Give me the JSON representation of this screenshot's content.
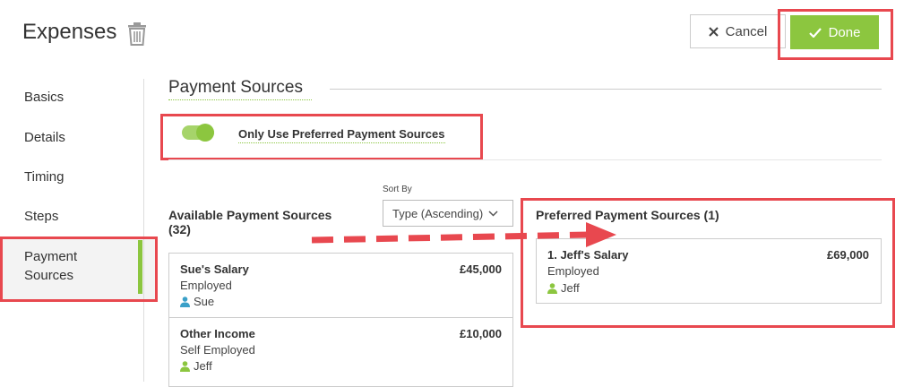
{
  "header": {
    "title": "Expenses",
    "cancel_label": "Cancel",
    "done_label": "Done"
  },
  "sidebar": {
    "items": [
      {
        "label": "Basics"
      },
      {
        "label": "Details"
      },
      {
        "label": "Timing"
      },
      {
        "label": "Steps"
      },
      {
        "label": "Payment Sources",
        "line1": "Payment",
        "line2": "Sources",
        "active": true
      }
    ]
  },
  "main": {
    "section_title": "Payment Sources",
    "toggle": {
      "label": "Only Use Preferred Payment Sources",
      "on": true
    },
    "available": {
      "title": "Available Payment Sources",
      "count": "(32)",
      "sort_label": "Sort By",
      "sort_value": "Type (Ascending)",
      "items": [
        {
          "name": "Sue's Salary",
          "type": "Employed",
          "person": "Sue",
          "amount": "£45,000",
          "person_color": "#3aa0c8"
        },
        {
          "name": "Other Income",
          "type": "Self Employed",
          "person": "Jeff",
          "amount": "£10,000",
          "person_color": "#8cc63f"
        }
      ]
    },
    "preferred": {
      "title": "Preferred Payment Sources (1)",
      "items": [
        {
          "name": "1. Jeff's Salary",
          "type": "Employed",
          "person": "Jeff",
          "amount": "£69,000",
          "person_color": "#8cc63f"
        }
      ]
    }
  },
  "colors": {
    "accent": "#8cc63f",
    "highlight": "#e8484f"
  }
}
